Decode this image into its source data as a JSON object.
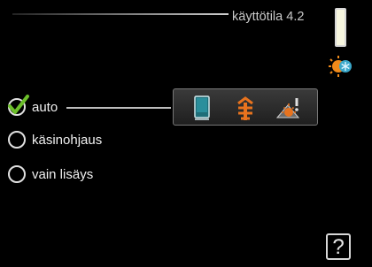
{
  "header": {
    "title": "käyttötila 4.2"
  },
  "options": [
    {
      "label": "auto",
      "selected": true
    },
    {
      "label": "käsinohjaus",
      "selected": false
    },
    {
      "label": "vain lisäys",
      "selected": false
    }
  ],
  "mode_panel": {
    "icons": [
      "heat-pump-icon",
      "additional-heat-icon",
      "heating-icon"
    ]
  },
  "status_icon": "sun-snowflake-icon",
  "help": {
    "label": "?"
  },
  "colors": {
    "background": "#000000",
    "accent_orange": "#e8731e",
    "teal": "#2a8f9c",
    "check_green": "#6cbf2a"
  }
}
